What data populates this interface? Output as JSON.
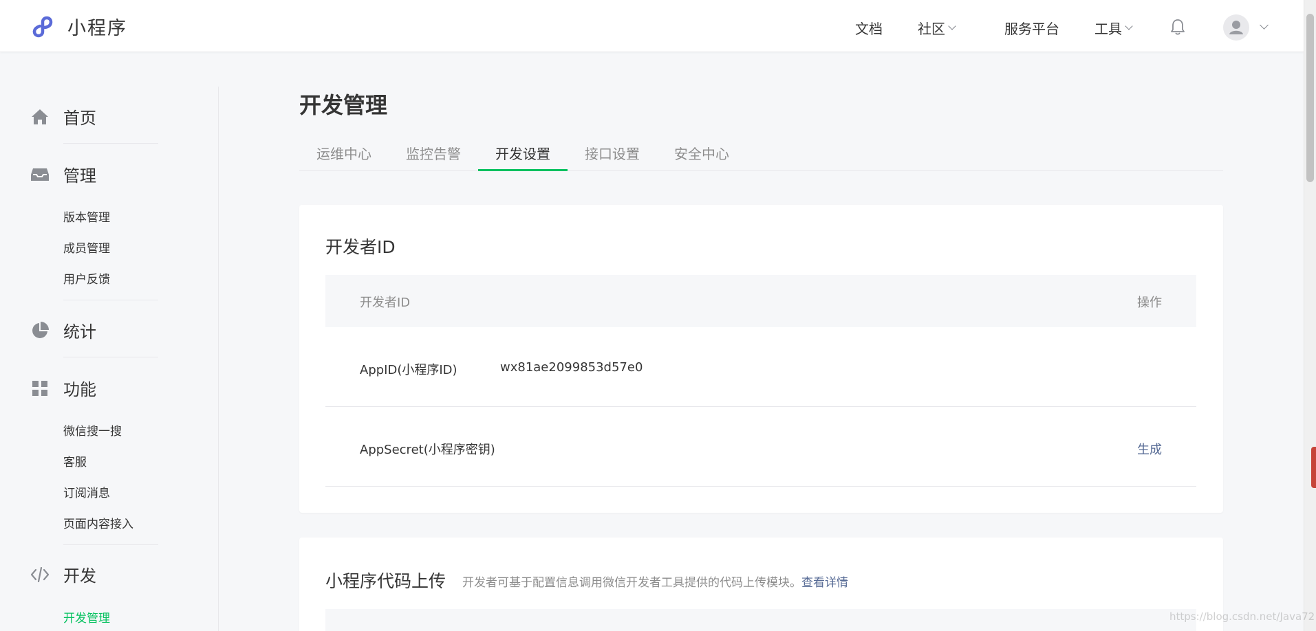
{
  "brand": {
    "name": "小程序"
  },
  "topnav": {
    "docs": "文档",
    "community": "社区",
    "service": "服务平台",
    "tools": "工具"
  },
  "sidebar": {
    "home": "首页",
    "manage": "管理",
    "manage_items": [
      "版本管理",
      "成员管理",
      "用户反馈"
    ],
    "stats": "统计",
    "features": "功能",
    "feature_items": [
      "微信搜一搜",
      "客服",
      "订阅消息",
      "页面内容接入"
    ],
    "dev": "开发",
    "dev_items": [
      "开发管理"
    ]
  },
  "page": {
    "title": "开发管理",
    "tabs": [
      "运维中心",
      "监控告警",
      "开发设置",
      "接口设置",
      "安全中心"
    ],
    "active_tab": "开发设置"
  },
  "developer_id": {
    "title": "开发者ID",
    "columns": [
      "开发者ID",
      "操作"
    ],
    "rows": [
      {
        "label": "AppID(小程序ID)",
        "value": "wx81ae2099853d57e0",
        "action": ""
      },
      {
        "label": "AppSecret(小程序密钥)",
        "value": "",
        "action": "生成"
      }
    ]
  },
  "code_upload": {
    "title": "小程序代码上传",
    "desc": "开发者可基于配置信息调用微信开发者工具提供的代码上传模块。",
    "link": "查看详情"
  },
  "watermark": "https://blog.csdn.net/Java72",
  "colors": {
    "accent": "#07c160",
    "link": "#576b95",
    "muted": "#8d8d8d",
    "text": "#353535",
    "bg": "#f6f7f9"
  }
}
